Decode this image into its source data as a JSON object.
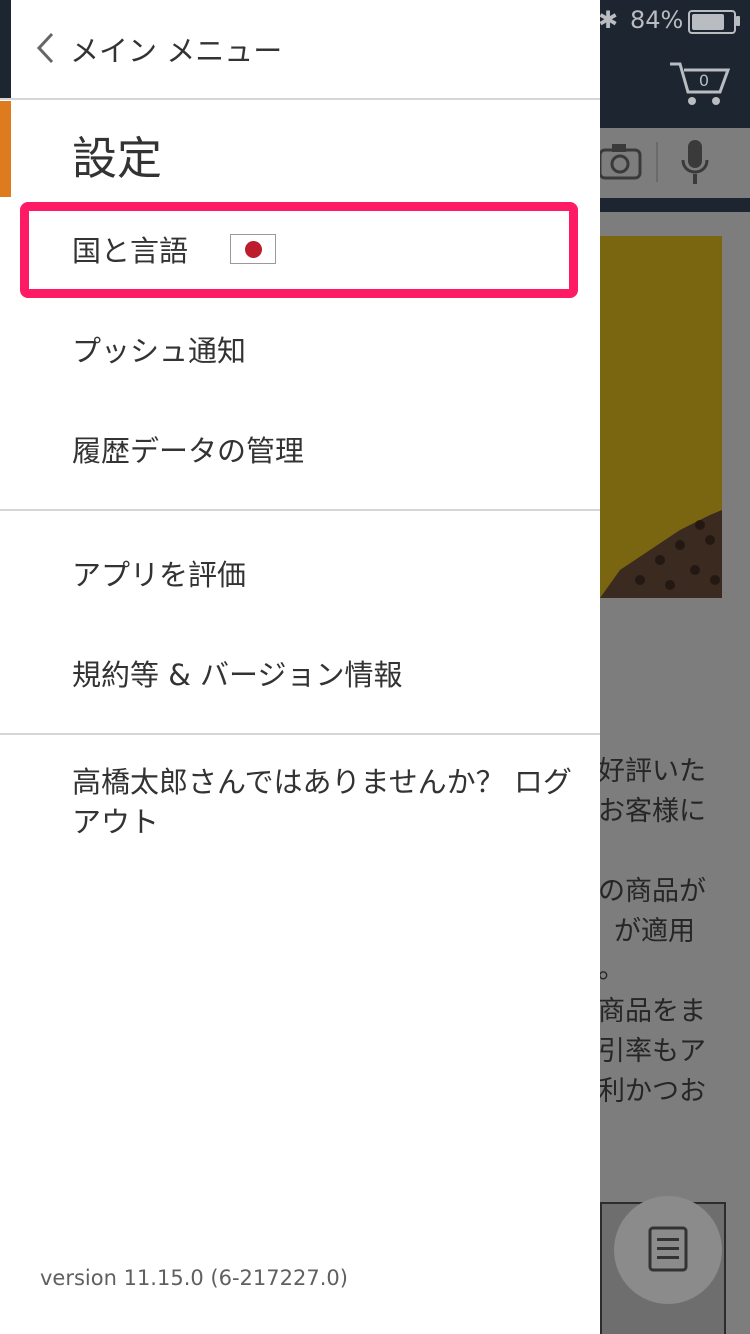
{
  "status_bar": {
    "battery_text": "84%"
  },
  "drawer": {
    "back_label": "メイン メニュー",
    "section_title": "設定",
    "items": [
      {
        "label": "国と言語",
        "flag": "Japan"
      },
      {
        "label": "プッシュ通知"
      },
      {
        "label": "履歴データの管理"
      },
      {
        "label": "アプリを評価"
      },
      {
        "label": "規約等 & バージョン情報"
      }
    ],
    "logout_text": "高橋太郎さんではありませんか？ ログアウト",
    "version": "version 11.15.0 (6-217227.0)"
  },
  "background": {
    "text_lines": [
      "好評いた",
      "お客様に",
      "の商品が",
      "が適用",
      "。",
      "商品をま",
      "引率もア",
      "利かつお"
    ]
  },
  "colors": {
    "highlight": "#ff1a66",
    "header_dark": "#1d2530",
    "accent_orange": "#dd7b1e",
    "flag_red": "#bc1c2c"
  }
}
